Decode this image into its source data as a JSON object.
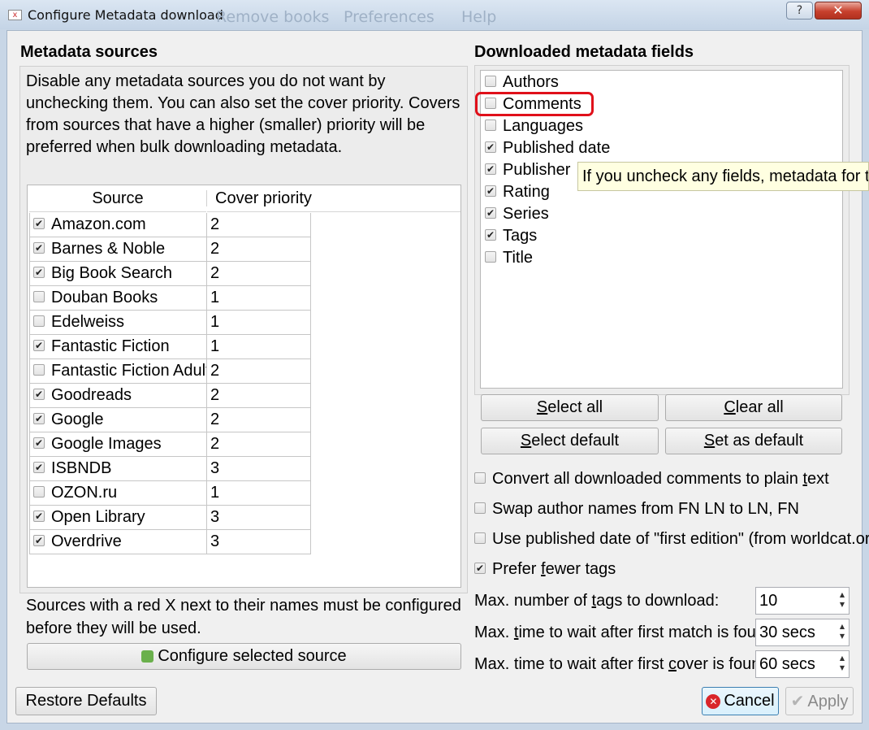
{
  "window": {
    "title": "Configure Metadata download",
    "help_glyph": "?",
    "close_glyph": "✕",
    "background_menu": [
      "Remove books",
      "Preferences",
      "Help"
    ]
  },
  "sources_group": {
    "title": "Metadata sources",
    "description": "Disable any metadata sources you do not want by unchecking them. You can also set the cover priority. Covers from sources that have a higher (smaller) priority will be preferred when bulk downloading metadata.",
    "columns": [
      "Source",
      "Cover priority"
    ],
    "rows": [
      {
        "name": "Amazon.com",
        "checked": true,
        "priority": "2"
      },
      {
        "name": "Barnes & Noble",
        "checked": true,
        "priority": "2"
      },
      {
        "name": "Big Book Search",
        "checked": true,
        "priority": "2"
      },
      {
        "name": "Douban Books",
        "checked": false,
        "priority": "1"
      },
      {
        "name": "Edelweiss",
        "checked": false,
        "priority": "1"
      },
      {
        "name": "Fantastic Fiction",
        "checked": true,
        "priority": "1"
      },
      {
        "name": "Fantastic Fiction Adults",
        "checked": false,
        "priority": "2"
      },
      {
        "name": "Goodreads",
        "checked": true,
        "priority": "2"
      },
      {
        "name": "Google",
        "checked": true,
        "priority": "2"
      },
      {
        "name": "Google Images",
        "checked": true,
        "priority": "2"
      },
      {
        "name": "ISBNDB",
        "checked": true,
        "priority": "3"
      },
      {
        "name": "OZON.ru",
        "checked": false,
        "priority": "1"
      },
      {
        "name": "Open Library",
        "checked": true,
        "priority": "3"
      },
      {
        "name": "Overdrive",
        "checked": true,
        "priority": "3"
      }
    ],
    "note": "Sources with a red X next to their names must be configured before they will be used.",
    "configure_button": "Configure selected source",
    "configure_icon": "puzzle-piece-icon"
  },
  "fields_group": {
    "title": "Downloaded metadata fields",
    "fields": [
      {
        "name": "Authors",
        "checked": false
      },
      {
        "name": "Comments",
        "checked": false
      },
      {
        "name": "Languages",
        "checked": false
      },
      {
        "name": "Published date",
        "checked": true
      },
      {
        "name": "Publisher",
        "checked": true
      },
      {
        "name": "Rating",
        "checked": true
      },
      {
        "name": "Series",
        "checked": true
      },
      {
        "name": "Tags",
        "checked": true
      },
      {
        "name": "Title",
        "checked": false
      }
    ],
    "tooltip": "If you uncheck any fields, metadata for those",
    "buttons": {
      "select_all": {
        "pre": "",
        "u": "S",
        "post": "elect all"
      },
      "clear_all": {
        "pre": "",
        "u": "C",
        "post": "lear all"
      },
      "select_default": {
        "pre": "",
        "u": "S",
        "post": "elect default"
      },
      "set_as_default": {
        "pre": "",
        "u": "S",
        "post": "et as default"
      }
    },
    "highlight_color": "#e0101a"
  },
  "options": [
    {
      "pre": "Convert all downloaded comments to plain ",
      "u": "t",
      "post": "ext",
      "checked": false
    },
    {
      "pre": "Swap author names from FN LN to LN, FN",
      "u": "",
      "post": "",
      "checked": false
    },
    {
      "pre": "Use published date of \"first edition\" (from worldcat.org)",
      "u": "",
      "post": "",
      "checked": false
    },
    {
      "pre": "Prefer ",
      "u": "f",
      "post": "ewer tags",
      "checked": true
    }
  ],
  "spinners": [
    {
      "pre": "Max. number of ",
      "u": "t",
      "post": "ags to download:",
      "value": "10"
    },
    {
      "pre": "Max. ",
      "u": "t",
      "post": "ime to wait after first match is found:",
      "value": "30 secs"
    },
    {
      "pre": "Max. time to wait after first ",
      "u": "c",
      "post": "over is found:",
      "value": "60 secs"
    }
  ],
  "footer": {
    "restore_defaults": "Restore Defaults",
    "cancel": "Cancel",
    "apply": "Apply",
    "cancel_color": "#d9262b"
  }
}
